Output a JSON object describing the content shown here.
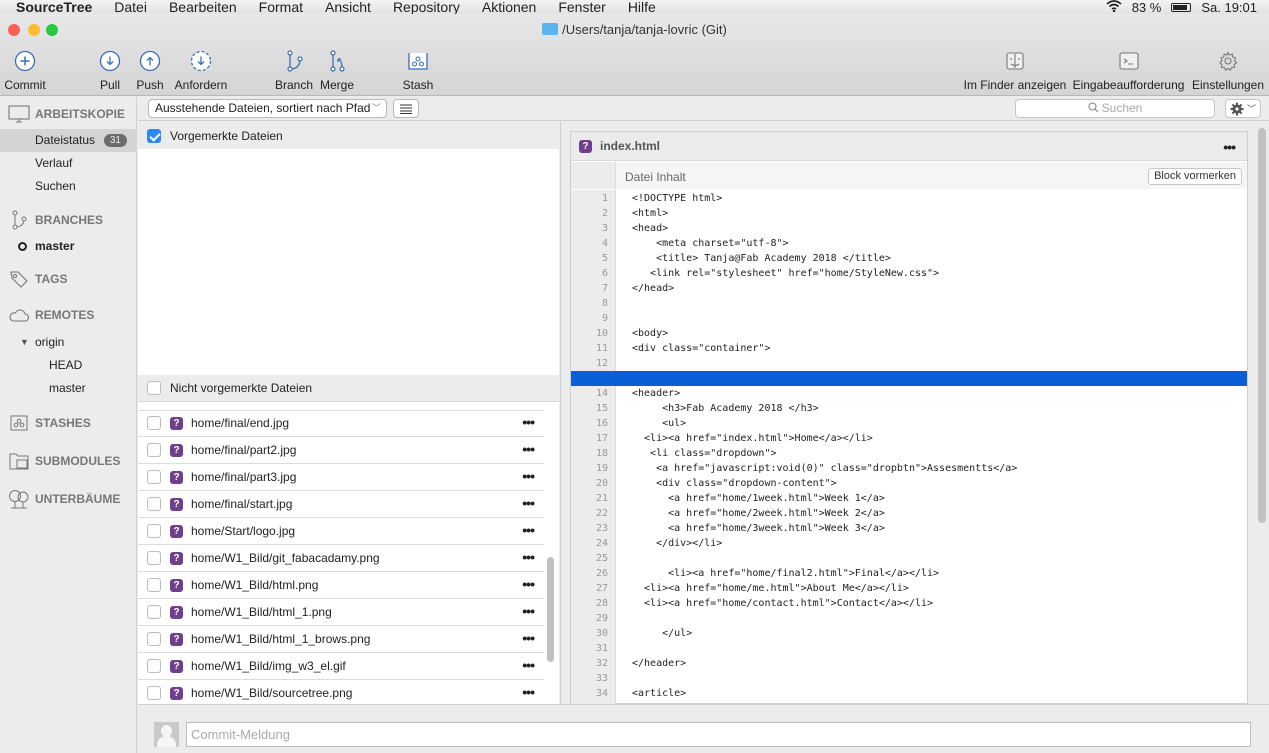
{
  "menubar": {
    "app": "SourceTree",
    "items": [
      "Datei",
      "Bearbeiten",
      "Format",
      "Ansicht",
      "Repository",
      "Aktionen",
      "Fenster",
      "Hilfe"
    ],
    "battery": "83 %",
    "clock": "Sa. 19:01"
  },
  "window": {
    "title": "/Users/tanja/tanja-lovric (Git)"
  },
  "toolbar": {
    "commit": "Commit",
    "pull": "Pull",
    "push": "Push",
    "fetch": "Anfordern",
    "branch": "Branch",
    "merge": "Merge",
    "stash": "Stash",
    "finder": "Im Finder anzeigen",
    "terminal": "Eingabeaufforderung",
    "settings": "Einstellungen"
  },
  "sidebar": {
    "workspace": "ARBEITSKOPIE",
    "file_status": "Dateistatus",
    "file_status_count": "31",
    "history": "Verlauf",
    "search": "Suchen",
    "branches": "BRANCHES",
    "current_branch": "master",
    "tags": "TAGS",
    "remotes": "REMOTES",
    "remote_origin": "origin",
    "remote_head": "HEAD",
    "remote_master": "master",
    "stashes": "STASHES",
    "submodules": "SUBMODULES",
    "subtrees": "UNTERBÄUME"
  },
  "filterbar": {
    "sort_mode": "Ausstehende Dateien, sortiert nach Pfad",
    "search_placeholder": "Suchen"
  },
  "staged": {
    "header": "Vorgemerkte Dateien",
    "checked": true
  },
  "unstaged": {
    "header": "Nicht vorgemerkte Dateien",
    "files": [
      "home/final/end.jpg",
      "home/final/part2.jpg",
      "home/final/part3.jpg",
      "home/final/start.jpg",
      "home/Start/logo.jpg",
      "home/W1_Bild/git_fabacadamy.png",
      "home/W1_Bild/html.png",
      "home/W1_Bild/html_1.png",
      "home/W1_Bild/html_1_brows.png",
      "home/W1_Bild/img_w3_el.gif",
      "home/W1_Bild/sourcetree.png"
    ]
  },
  "diff": {
    "filename": "index.html",
    "hunk_title": "Datei Inhalt",
    "stage_hunk": "Block vormerken",
    "selected_line": 13,
    "lines": [
      "<!DOCTYPE html>",
      "<html>",
      "<head>",
      "    <meta charset=\"utf-8\">",
      "    <title> Tanja@Fab Academy 2018 </title>",
      "   <link rel=\"stylesheet\" href=\"home/StyleNew.css\">",
      "</head>",
      "",
      "",
      "<body>",
      "<div class=\"container\">",
      "",
      "",
      "<header>",
      "     <h3>Fab Academy 2018 </h3>",
      "     <ul>",
      "  <li><a href=\"index.html\">Home</a></li>",
      "   <li class=\"dropdown\">",
      "    <a href=\"javascript:void(0)\" class=\"dropbtn\">Assesmentts</a>",
      "    <div class=\"dropdown-content\">",
      "      <a href=\"home/1week.html\">Week 1</a>",
      "      <a href=\"home/2week.html\">Week 2</a>",
      "      <a href=\"home/3week.html\">Week 3</a>",
      "    </div></li>",
      "",
      "      <li><a href=\"home/final2.html\">Final</a></li>",
      "  <li><a href=\"home/me.html\">About Me</a></li>",
      "  <li><a href=\"home/contact.html\">Contact</a></li>",
      "",
      "     </ul>",
      "",
      "</header>",
      "",
      "<article>"
    ]
  },
  "commit": {
    "placeholder": "Commit-Meldung"
  }
}
